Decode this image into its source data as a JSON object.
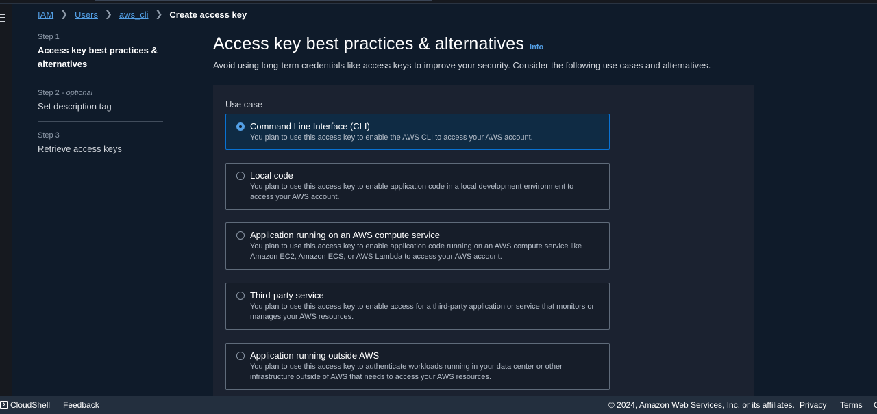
{
  "breadcrumb": {
    "items": [
      "IAM",
      "Users",
      "aws_cli"
    ],
    "current": "Create access key"
  },
  "steps": [
    {
      "num": "Step 1",
      "optional": "",
      "title": "Access key best practices & alternatives"
    },
    {
      "num": "Step 2 - ",
      "optional": "optional",
      "title": "Set description tag"
    },
    {
      "num": "Step 3",
      "optional": "",
      "title": "Retrieve access keys"
    }
  ],
  "header": {
    "title": "Access key best practices & alternatives",
    "info": "Info",
    "subtitle": "Avoid using long-term credentials like access keys to improve your security. Consider the following use cases and alternatives."
  },
  "usecase": {
    "label": "Use case",
    "selected": "Command Line Interface (CLI)",
    "options": [
      {
        "title": "Command Line Interface (CLI)",
        "desc": "You plan to use this access key to enable the AWS CLI to access your AWS account."
      },
      {
        "title": "Local code",
        "desc": "You plan to use this access key to enable application code in a local development environment to access your AWS account."
      },
      {
        "title": "Application running on an AWS compute service",
        "desc": "You plan to use this access key to enable application code running on an AWS compute service like Amazon EC2, Amazon ECS, or AWS Lambda to access your AWS account."
      },
      {
        "title": "Third-party service",
        "desc": "You plan to use this access key to enable access for a third-party application or service that monitors or manages your AWS resources."
      },
      {
        "title": "Application running outside AWS",
        "desc": "You plan to use this access key to authenticate workloads running in your data center or other infrastructure outside of AWS that needs to access your AWS resources."
      }
    ]
  },
  "footer": {
    "cloudshell": "CloudShell",
    "feedback": "Feedback",
    "copyright": "© 2024, Amazon Web Services, Inc. or its affiliates.",
    "privacy": "Privacy",
    "terms": "Terms",
    "edge": "C"
  },
  "icons": {
    "menu": "hamburger-menu-icon",
    "cloudshell": "cloudshell-terminal-icon"
  },
  "colors": {
    "accent": "#539fe5",
    "selected_border": "#0972d3",
    "background": "#0f1b2a",
    "panel": "#1b2230"
  }
}
